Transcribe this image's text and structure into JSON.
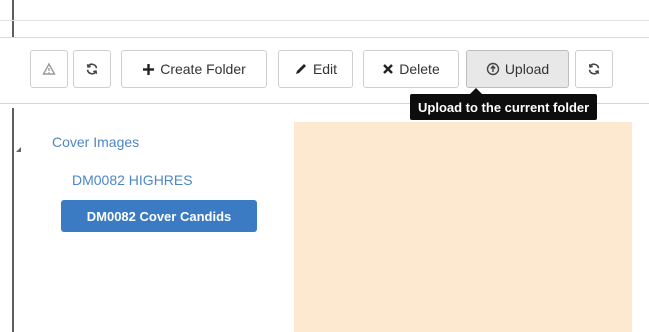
{
  "toolbar": {
    "buttons": [
      {
        "name": "warning-button",
        "icon": "warning-icon",
        "label": ""
      },
      {
        "name": "refresh-button",
        "icon": "refresh-icon",
        "label": ""
      },
      {
        "name": "create-folder-button",
        "icon": "plus-icon",
        "label": "Create Folder"
      },
      {
        "name": "edit-button",
        "icon": "pencil-icon",
        "label": "Edit"
      },
      {
        "name": "delete-button",
        "icon": "x-icon",
        "label": "Delete"
      },
      {
        "name": "upload-button",
        "icon": "upload-icon",
        "label": "Upload"
      },
      {
        "name": "refresh-button-2",
        "icon": "refresh-icon",
        "label": ""
      }
    ]
  },
  "tooltip": {
    "text": "Upload to the current folder"
  },
  "tree": {
    "root": {
      "label": "Cover Images",
      "children": [
        {
          "label": "DM0082 HIGHRES"
        },
        {
          "label": "DM0082 Cover Candids",
          "selected": true
        }
      ]
    }
  },
  "colors": {
    "link_blue": "#4e86c5",
    "selected_blue": "#3a7bc3",
    "content_bg": "#fde9d0",
    "tooltip_bg": "#0d0d0d"
  }
}
